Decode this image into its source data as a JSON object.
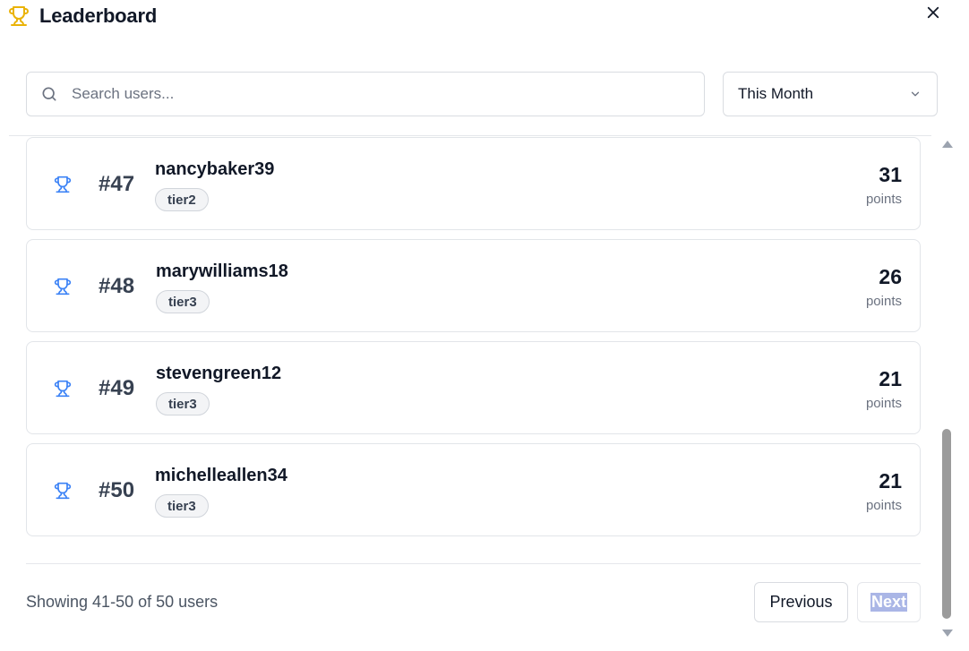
{
  "header": {
    "title": "Leaderboard",
    "icon": "trophy-icon",
    "accent_color": "#eab308"
  },
  "search": {
    "placeholder": "Search users...",
    "value": ""
  },
  "period": {
    "selected": "This Month"
  },
  "entries": [
    {
      "rank": "#47",
      "username": "nancybaker39",
      "tier": "tier2",
      "score": "31",
      "score_label": "points"
    },
    {
      "rank": "#48",
      "username": "marywilliams18",
      "tier": "tier3",
      "score": "26",
      "score_label": "points"
    },
    {
      "rank": "#49",
      "username": "stevengreen12",
      "tier": "tier3",
      "score": "21",
      "score_label": "points"
    },
    {
      "rank": "#50",
      "username": "michelleallen34",
      "tier": "tier3",
      "score": "21",
      "score_label": "points"
    }
  ],
  "row_icon_color": "#3b82f6",
  "footer": {
    "showing": "Showing 41-50 of 50 users",
    "previous_label": "Previous",
    "next_label": "Next"
  }
}
